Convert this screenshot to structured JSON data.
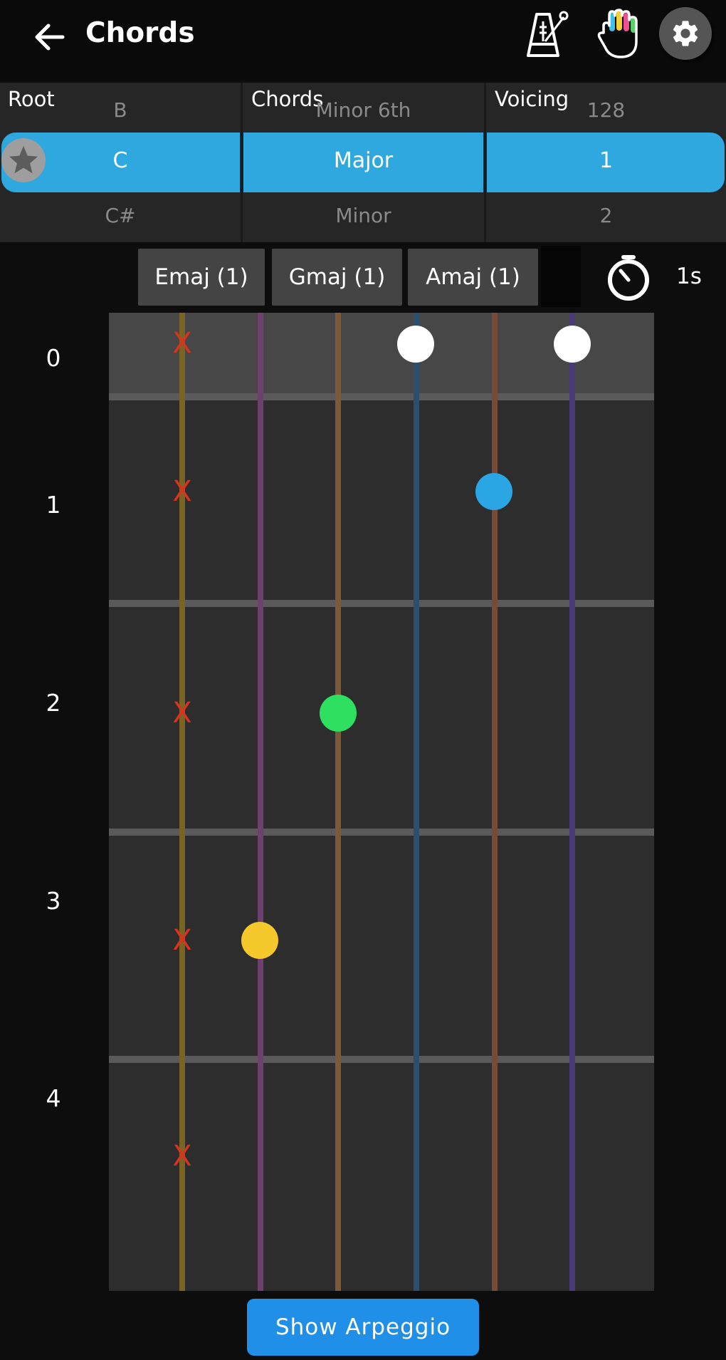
{
  "header": {
    "title": "Chords"
  },
  "picker": {
    "root": {
      "label": "Root",
      "above": "B",
      "selected": "C",
      "below": "C#"
    },
    "chords": {
      "label": "Chords",
      "above": "Minor 6th",
      "selected": "Major",
      "below": "Minor"
    },
    "voicing": {
      "label": "Voicing",
      "above": "128",
      "selected": "1",
      "below": "2"
    }
  },
  "chips": [
    "Emaj (1)",
    "Gmaj (1)",
    "Amaj (1)"
  ],
  "timer": {
    "label": "1s"
  },
  "frets": [
    "0",
    "1",
    "2",
    "3",
    "4"
  ],
  "string_colors": [
    "#7a6424",
    "#6e3f6f",
    "#7a5a3a",
    "#2c4f6e",
    "#7a4a38",
    "#4b3a78"
  ],
  "dot_colors": {
    "open": "#ffffff",
    "fret1": "#29a6e3",
    "fret2": "#2ee05f",
    "fret3": "#f5c92c"
  },
  "x_mark": "X",
  "buttons": {
    "arpeggio": "Show Arpeggio"
  }
}
